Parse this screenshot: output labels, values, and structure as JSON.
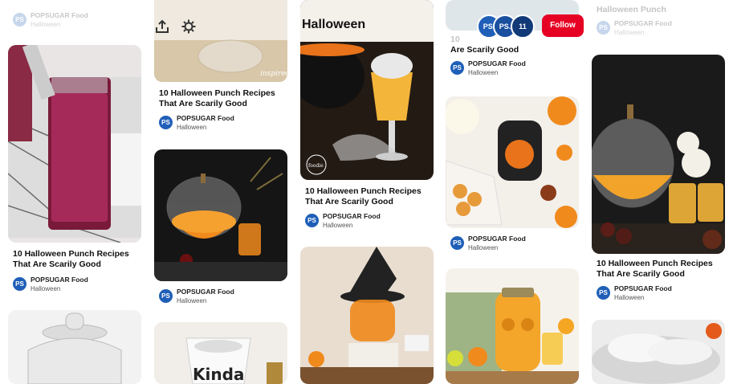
{
  "header": {
    "board_title": "Halloween",
    "share_icon": "upload-share-icon",
    "settings_icon": "gear-icon",
    "follower_badge_1": "PS.",
    "follower_badge_2": "PS.",
    "follower_count": "11",
    "follow_label": "Follow"
  },
  "pin_title": "10 Halloween Punch Recipes That Are Scarily Good",
  "author": "POPSUGAR Food",
  "board": "Halloween",
  "avatar_label": "PS",
  "pins": {
    "c1_top": {
      "author": "POPSUGAR Food",
      "board": "Halloween"
    },
    "c1_a": {
      "title": "10 Halloween Punch Recipes That Are Scarily Good",
      "author": "POPSUGAR Food",
      "board": "Halloween"
    },
    "c2_a": {
      "title": "10 Halloween Punch Recipes That Are Scarily Good",
      "author": "POPSUGAR Food",
      "board": "Halloween",
      "watermark": "inspired"
    },
    "c2_b": {
      "author": "POPSUGAR Food",
      "board": "Halloween"
    },
    "c2_c": {
      "text": "Kinda"
    },
    "c3_a": {
      "title": "10 Halloween Punch Recipes That Are Scarily Good",
      "author": "POPSUGAR Food",
      "board": "Halloween",
      "watermark": "foodie"
    },
    "c4_a": {
      "title_tail": "Are Scarily Good",
      "title_head": "10",
      "author": "POPSUGAR Food",
      "board": "Halloween"
    },
    "c4_b": {
      "author": "POPSUGAR Food",
      "board": "Halloween"
    },
    "c5_top": {
      "title": "Halloween Punch",
      "author": "POPSUGAR Food",
      "board": "Halloween"
    },
    "c5_a": {
      "title": "10 Halloween Punch Recipes That Are Scarily Good",
      "author": "POPSUGAR Food",
      "board": "Halloween"
    }
  },
  "colors": {
    "follow": "#e60023",
    "avatar": "#1f5fb8"
  }
}
